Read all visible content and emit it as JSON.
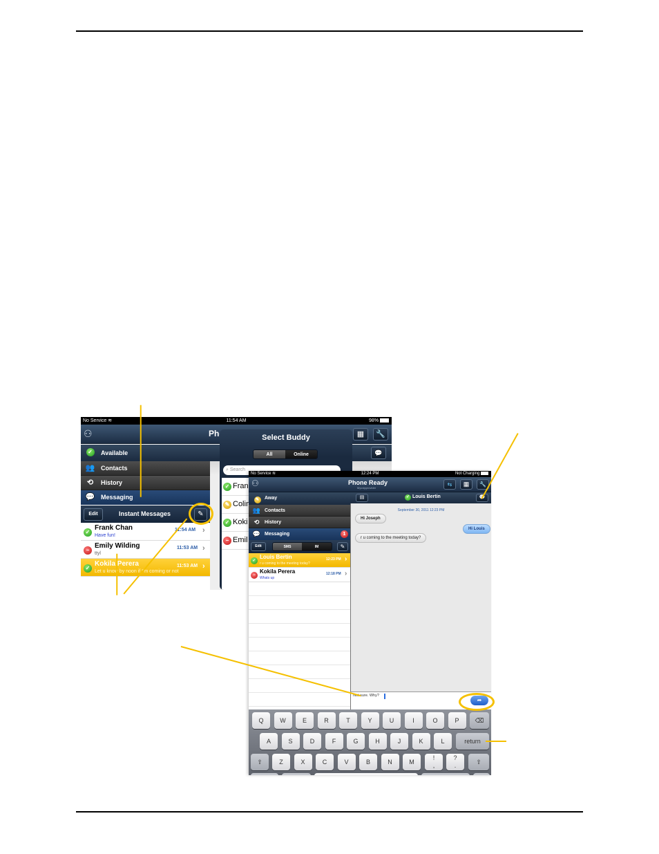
{
  "back_screen": {
    "status": {
      "carrier": "No Service",
      "time": "11:54 AM",
      "battery": "98%"
    },
    "app_title": "Phone Ready",
    "sidebar": {
      "presence": "Available",
      "items": [
        {
          "label": "Contacts",
          "icon": "contacts-icon"
        },
        {
          "label": "History",
          "icon": "history-icon"
        },
        {
          "label": "Messaging",
          "icon": "messaging-icon"
        }
      ]
    },
    "toolbar": {
      "edit": "Edit",
      "title": "Instant Messages"
    },
    "conversations": [
      {
        "name": "Frank Chan",
        "message": "Have fun!",
        "time": "11:54 AM",
        "status": "available"
      },
      {
        "name": "Emily Wilding",
        "message": "ttyl",
        "time": "11:53 AM",
        "status": "busy"
      },
      {
        "name": "Kokila Perera",
        "message": "Let u know by noon if I'm coming or not",
        "time": "11:53 AM",
        "status": "available",
        "selected": true
      }
    ],
    "popover": {
      "title": "Select Buddy",
      "segments": [
        "All",
        "Online"
      ],
      "active_segment": "All",
      "search_placeholder": "Search",
      "buddies": [
        {
          "name": "Fran",
          "status": "available"
        },
        {
          "name": "Colin",
          "status": "away"
        },
        {
          "name": "Koki",
          "status": "available"
        },
        {
          "name": "Emil",
          "status": "busy"
        }
      ]
    }
  },
  "front_screen": {
    "status": {
      "carrier": "No Service",
      "time": "12:24 PM",
      "battery": "Not Charging"
    },
    "app_title": "Phone Ready",
    "app_subtitle": "Myvoipprovider",
    "sidebar": {
      "presence": "Away",
      "items": [
        {
          "label": "Contacts"
        },
        {
          "label": "History"
        },
        {
          "label": "Messaging",
          "badge": "1"
        }
      ]
    },
    "toolbar": {
      "edit": "Edit",
      "segments": [
        "SMS",
        "IM"
      ],
      "active_segment": "SMS"
    },
    "conversations": [
      {
        "name": "Louis Bertin",
        "message": "r u coming to the meeting today?",
        "time": "12:23 PM",
        "status": "available",
        "selected": true
      },
      {
        "name": "Kokila Perera",
        "message": "Whats up",
        "time": "12:18 PM",
        "status": "busy"
      }
    ],
    "chat": {
      "contact": "Louis Bertin",
      "date": "September 30, 2011 12:23 PM",
      "messages": [
        {
          "text": "Hi Joseph",
          "direction": "in"
        },
        {
          "text": "Hi Louis",
          "direction": "out"
        },
        {
          "text": "r u coming to the meeting today?",
          "direction": "in"
        }
      ],
      "input_value": "Not sure. Why?"
    },
    "keyboard": {
      "row1": [
        "Q",
        "W",
        "E",
        "R",
        "T",
        "Y",
        "U",
        "I",
        "O",
        "P"
      ],
      "row2": [
        "A",
        "S",
        "D",
        "F",
        "G",
        "H",
        "J",
        "K",
        "L"
      ],
      "row3": [
        "Z",
        "X",
        "C",
        "V",
        "B",
        "N",
        "M"
      ],
      "return": "return",
      "punct1": [
        "!",
        ","
      ],
      "punct2": [
        "?",
        "."
      ],
      "shift": "⇧",
      "delete": "⌫"
    }
  },
  "colors": {
    "callout": "#f5c000",
    "navy": "#1c2d44",
    "selected": "#f3b800",
    "link_blue": "#2a3fd0"
  }
}
